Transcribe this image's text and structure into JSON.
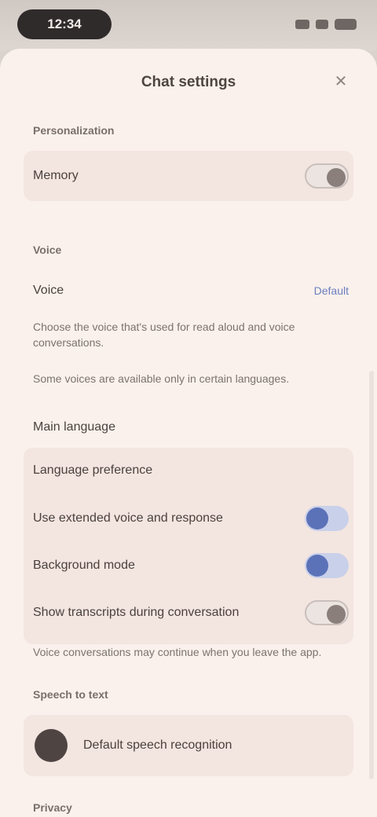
{
  "status_bar": {
    "time": "12:34"
  },
  "sheet": {
    "title": "Chat settings",
    "close_icon": "close-icon"
  },
  "section1": {
    "heading": "Personalization",
    "toggle_label": "Memory",
    "toggle_value": false
  },
  "section2": {
    "heading": "Voice",
    "voice_label": "Voice",
    "voice_value": "Default",
    "description_1": "Choose the voice that's used for read aloud and voice conversations.",
    "description_2": "Some voices are available only in certain languages.",
    "option_1": "Main language",
    "option_2": "Language preference",
    "toggle_1_label": "Use extended voice and response",
    "toggle_1_value": true,
    "toggle_2_label": "Background mode",
    "toggle_2_value": true,
    "toggle_3_label": "Show transcripts during conversation",
    "toggle_3_value": false,
    "footer_text": "Voice conversations may continue when you leave the app."
  },
  "section3": {
    "heading": "Speech to text",
    "profile_label": "Default speech recognition"
  },
  "section4": {
    "heading": "Privacy"
  }
}
